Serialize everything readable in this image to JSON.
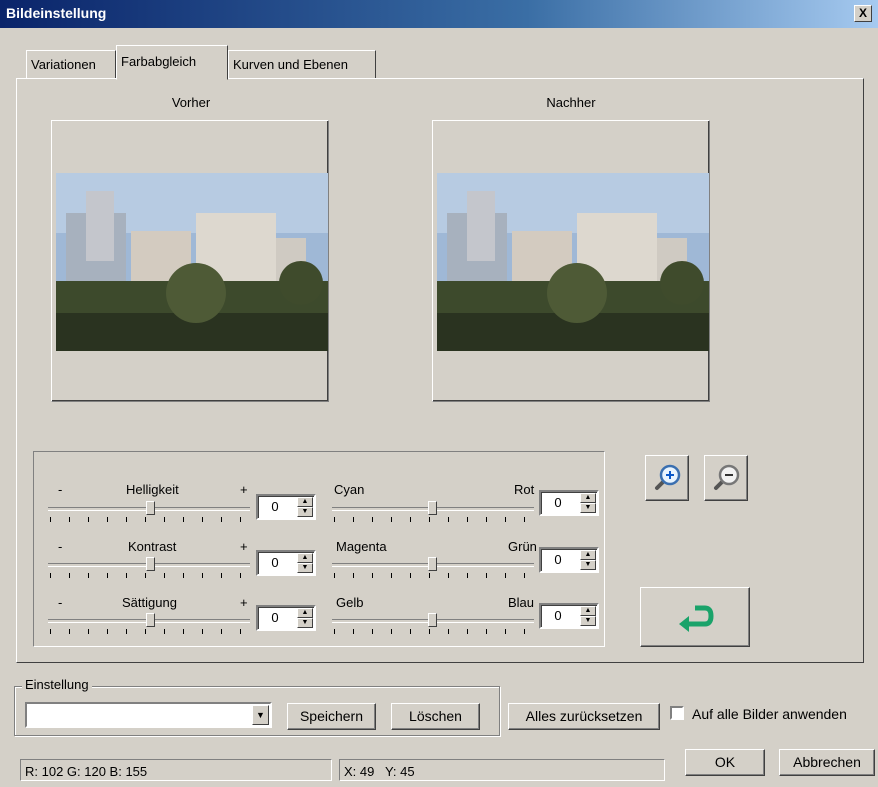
{
  "window": {
    "title": "Bildeinstellung",
    "close_label": "X"
  },
  "tabs": [
    {
      "label": "Variationen",
      "active": false
    },
    {
      "label": "Farbabgleich",
      "active": true
    },
    {
      "label": "Kurven und Ebenen",
      "active": false
    }
  ],
  "previews": {
    "before_label": "Vorher",
    "after_label": "Nachher"
  },
  "left_sliders": [
    {
      "name": "Helligkeit",
      "minus": "-",
      "plus": "+",
      "value": "0"
    },
    {
      "name": "Kontrast",
      "minus": "-",
      "plus": "+",
      "value": "0"
    },
    {
      "name": "Sättigung",
      "minus": "-",
      "plus": "+",
      "value": "0"
    }
  ],
  "right_sliders": [
    {
      "left": "Cyan",
      "right": "Rot",
      "value": "0"
    },
    {
      "left": "Magenta",
      "right": "Grün",
      "value": "0"
    },
    {
      "left": "Gelb",
      "right": "Blau",
      "value": "0"
    }
  ],
  "icons": {
    "zoom_in": "zoom-in-icon",
    "zoom_out": "zoom-out-icon",
    "reset": "undo-arrow-icon"
  },
  "einstellung": {
    "label": "Einstellung",
    "selected": "",
    "save": "Speichern",
    "delete": "Löschen"
  },
  "reset_all": "Alles zurücksetzen",
  "apply_all": {
    "label": "Auf alle Bilder anwenden",
    "checked": false
  },
  "status": {
    "rgb": "R: 102 G: 120 B: 155",
    "xy": "X: 49   Y: 45"
  },
  "buttons": {
    "ok": "OK",
    "cancel": "Abbrechen"
  },
  "colors": {
    "titlebar": "#0a246a",
    "face": "#d4d0c8",
    "accent_green": "#1aa36a"
  }
}
